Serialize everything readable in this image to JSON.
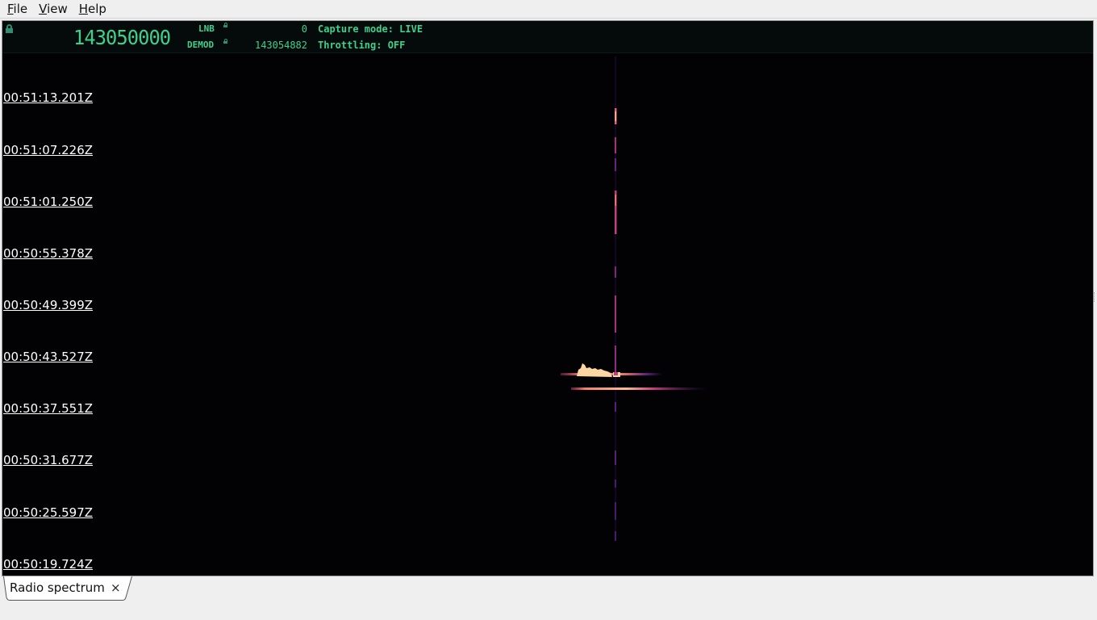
{
  "menubar": {
    "items": [
      {
        "mnemonic": "F",
        "rest": "ile"
      },
      {
        "mnemonic": "V",
        "rest": "iew"
      },
      {
        "mnemonic": "H",
        "rest": "elp"
      }
    ]
  },
  "header": {
    "main_frequency": "143050000",
    "lnb_label": "LNB",
    "lnb_value": "0",
    "demod_label": "DEMOD",
    "demod_value": "143054882",
    "capture_mode": "Capture mode: LIVE",
    "throttling": "Throttling: OFF"
  },
  "waterfall": {
    "timestamps": [
      "00:51:13.201Z",
      "00:51:07.226Z",
      "00:51:01.250Z",
      "00:50:55.378Z",
      "00:50:49.399Z",
      "00:50:43.527Z",
      "00:50:37.551Z",
      "00:50:31.677Z",
      "00:50:25.597Z",
      "00:50:19.724Z"
    ],
    "colors": {
      "background": "#020204",
      "weak": "#5a1f7a",
      "medium": "#c43d7e",
      "strong": "#f57e69",
      "peak": "#fcd5a4"
    }
  },
  "tabs": [
    {
      "label": "Radio spectrum",
      "close_glyph": "×"
    }
  ]
}
